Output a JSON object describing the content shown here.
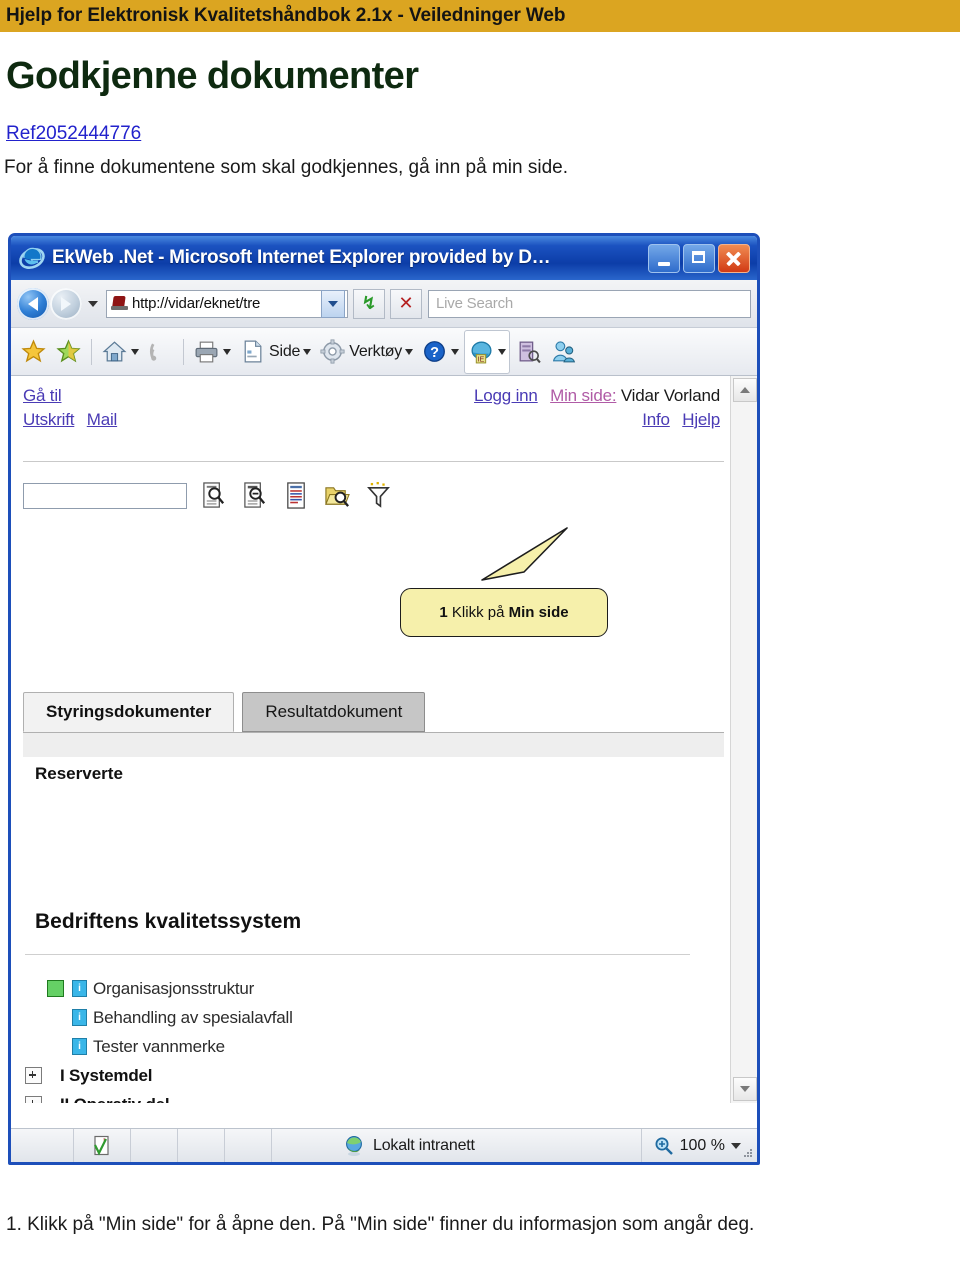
{
  "document": {
    "header_bar_title": "Hjelp for Elektronisk Kvalitetshåndbok 2.1x - Veiledninger Web",
    "header_bar_color": "#dba521",
    "title": "Godkjenne dokumenter",
    "title_color": "#0e2a10",
    "ref_link": "Ref2052444776",
    "ref_link_color": "#2222cc",
    "intro": "For å finne dokumentene som skal godkjennes, gå inn på min side.",
    "footer_step": "1. Klikk på \"Min side\" for å åpne den. På \"Min side\" finner du informasjon som angår deg."
  },
  "browser": {
    "titlebar": {
      "title": "EkWeb .Net - Microsoft Internet Explorer provided by D…",
      "app_icon": "internet-explorer-icon",
      "minimize": "minimize-icon",
      "maximize": "maximize-icon",
      "close": "close-icon",
      "bar_color": "#1b52c0"
    },
    "navbar": {
      "back": "back-arrow-icon",
      "forward": "forward-arrow-icon",
      "history_caret": "chevron-down-icon",
      "address_favicon": "page-favicon",
      "address_value": "http://vidar/eknet/tre",
      "address_dropdown": "chevron-down-icon",
      "refresh": "refresh-icon",
      "refresh_glyph": "↯",
      "stop": "stop-icon",
      "stop_glyph": "✕",
      "search_placeholder": "Live Search"
    },
    "toolbar": {
      "items": [
        {
          "name": "favorites-center-icon",
          "label": ""
        },
        {
          "name": "add-to-favorites-icon",
          "label": ""
        },
        {
          "name": "home-icon",
          "label": "",
          "caret": true
        },
        {
          "name": "feeds-icon",
          "label": ""
        },
        {
          "name": "print-icon",
          "label": "",
          "caret": true
        },
        {
          "name": "page-icon",
          "label": "Side",
          "caret": true
        },
        {
          "name": "tools-icon",
          "label": "Verktøy",
          "caret": true
        },
        {
          "name": "help-icon",
          "label": "",
          "caret": true
        },
        {
          "name": "ie-compat-icon",
          "label": "",
          "caret": true,
          "active": true
        },
        {
          "name": "research-icon",
          "label": ""
        },
        {
          "name": "messenger-icon",
          "label": ""
        }
      ]
    },
    "page": {
      "nav_left": [
        {
          "label": "Gå til",
          "type": "link"
        },
        {
          "label": "Utskrift",
          "type": "link"
        },
        {
          "label": "Mail",
          "type": "link"
        }
      ],
      "nav_right_row1": [
        {
          "label": "Logg inn",
          "type": "link"
        },
        {
          "label": "Min side:",
          "type": "link-visited"
        },
        {
          "label": "Vidar Vorland",
          "type": "text"
        }
      ],
      "nav_right_row2": [
        {
          "label": "Info",
          "type": "link"
        },
        {
          "label": "Hjelp",
          "type": "link"
        }
      ],
      "search_input_value": "",
      "search_tools": [
        "search-document-icon",
        "search-document-minus-icon",
        "report-list-icon",
        "folder-search-icon",
        "filter-funnel-icon"
      ],
      "callout": {
        "number": "1",
        "text_normal": " Klikk på ",
        "text_bold": "Min side",
        "bg_color": "#f6f0ab"
      },
      "tabs": [
        {
          "label": "Styringsdokumenter",
          "active": true
        },
        {
          "label": "Resultatdokument",
          "active": false
        }
      ],
      "tree_headings": {
        "reserved": "Reserverte",
        "system": "Bedriftens kvalitetssystem"
      },
      "tree_items": [
        {
          "label": "Organisasjonsstruktur",
          "icon": "info-doc-icon",
          "status_box": true,
          "expander": false,
          "bold": false
        },
        {
          "label": "Behandling av spesialavfall",
          "icon": "info-doc-icon",
          "status_box": false,
          "expander": false,
          "bold": false
        },
        {
          "label": "Tester vannmerke",
          "icon": "info-doc-icon",
          "status_box": false,
          "expander": false,
          "bold": false
        },
        {
          "label": "I Systemdel",
          "icon": "",
          "status_box": false,
          "expander": true,
          "bold": true
        },
        {
          "label": "II Operativ del",
          "icon": "",
          "status_box": false,
          "expander": true,
          "bold": true
        }
      ],
      "scrollbar": {
        "up": "scroll-up-arrow-icon",
        "down": "scroll-down-arrow-icon"
      }
    },
    "statusbar": {
      "security_icon": "security-report-icon",
      "zone_icon": "local-intranet-globe-icon",
      "zone_label": "Lokalt intranett",
      "zoom_icon": "zoom-magnifier-icon",
      "zoom_label": "100 %",
      "zoom_caret": "chevron-down-icon",
      "resize_grip": "resize-grip-icon"
    }
  }
}
